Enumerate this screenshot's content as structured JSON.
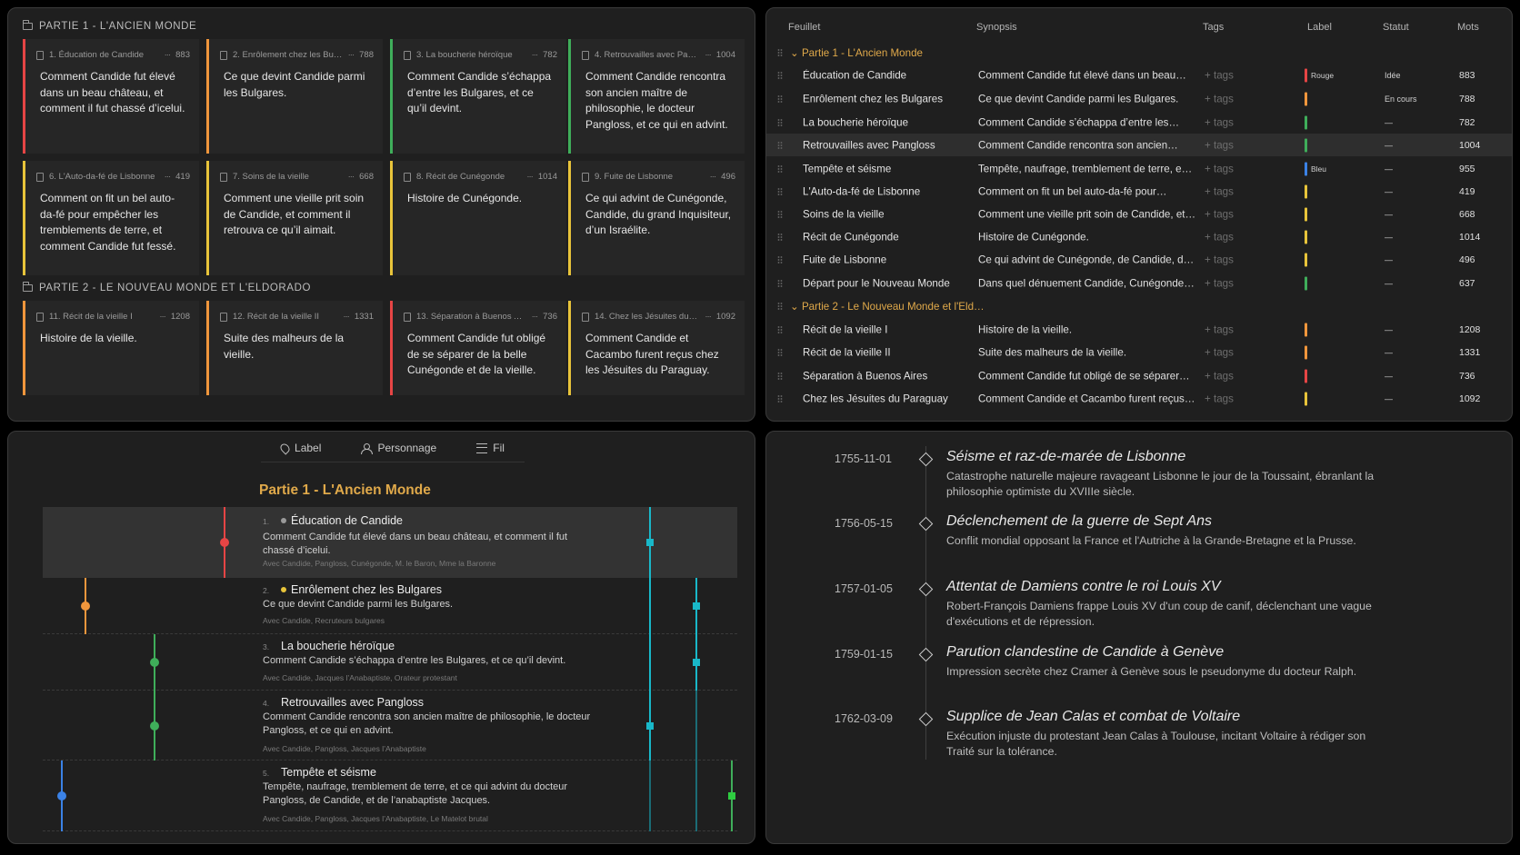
{
  "colors": {
    "bg": "#1f1f1f",
    "accent": "#e0a94a",
    "red": "#e64545",
    "orange": "#f0963c",
    "green": "#3fae5a",
    "yellow": "#e8c43a",
    "blue": "#3b82e6",
    "teal": "#19b8c9"
  },
  "corkboard": {
    "parts": [
      {
        "heading": "PARTIE 1 - L'ANCIEN MONDE",
        "cards": [
          {
            "title": "1. Éducation de Candide",
            "count": "883",
            "color": "red",
            "body": "Comment Candide fut élevé dans un beau château, et comment il fut chassé d’icelui."
          },
          {
            "title": "2. Enrôlement chez les Bulg…",
            "count": "788",
            "color": "orange",
            "body": "Ce que devint Candide parmi les Bulgares."
          },
          {
            "title": "3. La boucherie héroïque",
            "count": "782",
            "color": "green",
            "body": "Comment Candide s’échappa d’entre les Bulgares, et ce qu’il devint."
          },
          {
            "title": "4. Retrouvailles avec Pang…",
            "count": "1004",
            "color": "green",
            "body": "Comment Candide rencontra son ancien maître de philosophie, le docteur Pangloss, et ce qui en advint."
          },
          {
            "title": "6. L'Auto-da-fé de Lisbonne",
            "count": "419",
            "color": "yellow",
            "body": "Comment on fit un bel auto-da-fé pour empêcher les tremblements de terre, et comment Candide fut fessé."
          },
          {
            "title": "7. Soins de la vieille",
            "count": "668",
            "color": "yellow",
            "body": "Comment une vieille prit soin de Candide, et comment il retrouva ce qu’il aimait."
          },
          {
            "title": "8. Récit de Cunégonde",
            "count": "1014",
            "color": "yellow",
            "body": "Histoire de Cunégonde."
          },
          {
            "title": "9. Fuite de Lisbonne",
            "count": "496",
            "color": "yellow",
            "body": "Ce qui advint de Cunégonde, Candide, du grand Inquisiteur, d’un Israélite."
          }
        ]
      },
      {
        "heading": "PARTIE 2 - LE NOUVEAU MONDE ET L'ELDORADO",
        "cards": [
          {
            "title": "11. Récit de la vieille I",
            "count": "1208",
            "color": "orange",
            "body": "Histoire de la vieille."
          },
          {
            "title": "12. Récit de la vieille II",
            "count": "1331",
            "color": "orange",
            "body": "Suite des malheurs de la vieille."
          },
          {
            "title": "13. Séparation à Buenos Ai…",
            "count": "736",
            "color": "red",
            "body": "Comment Candide fut obligé de se séparer de la belle Cunégonde et de la vieille."
          },
          {
            "title": "14. Chez les Jésuites du…",
            "count": "1092",
            "color": "yellow",
            "body": "Comment Candide et Cacambo furent reçus chez les Jésuites du Paraguay."
          }
        ]
      }
    ]
  },
  "outline": {
    "headers": {
      "feuillet": "Feuillet",
      "synopsis": "Synopsis",
      "tags": "Tags",
      "label": "Label",
      "statut": "Statut",
      "mots": "Mots"
    },
    "rows": [
      {
        "kind": "part",
        "title": "Partie 1 - L'Ancien Monde"
      },
      {
        "kind": "doc",
        "title": "Éducation de Candide",
        "synopsis": "Comment Candide fut élevé dans un beau…",
        "tags": "+ tags",
        "color": "red",
        "label": "Rouge",
        "status": "Idée",
        "words": "883"
      },
      {
        "kind": "doc",
        "title": "Enrôlement chez les Bulgares",
        "synopsis": "Ce que devint Candide parmi les Bulgares.",
        "tags": "+ tags",
        "color": "orange",
        "label": "",
        "status": "En cours",
        "words": "788"
      },
      {
        "kind": "doc",
        "title": "La boucherie héroïque",
        "synopsis": "Comment Candide s’échappa d’entre les…",
        "tags": "+ tags",
        "color": "green",
        "label": "",
        "status": "—",
        "words": "782"
      },
      {
        "kind": "doc",
        "title": "Retrouvailles avec Pangloss",
        "synopsis": "Comment Candide rencontra son ancien…",
        "tags": "+ tags",
        "color": "green",
        "label": "",
        "status": "—",
        "words": "1004",
        "highlight": true
      },
      {
        "kind": "doc",
        "title": "Tempête et séisme",
        "synopsis": "Tempête, naufrage, tremblement de terre, e…",
        "tags": "+ tags",
        "color": "blue",
        "label": "Bleu",
        "status": "—",
        "words": "955"
      },
      {
        "kind": "doc",
        "title": "L'Auto-da-fé de Lisbonne",
        "synopsis": "Comment on fit un bel auto-da-fé pour…",
        "tags": "+ tags",
        "color": "yellow",
        "label": "",
        "status": "—",
        "words": "419"
      },
      {
        "kind": "doc",
        "title": "Soins de la vieille",
        "synopsis": "Comment une vieille prit soin de Candide, et…",
        "tags": "+ tags",
        "color": "yellow",
        "label": "",
        "status": "—",
        "words": "668"
      },
      {
        "kind": "doc",
        "title": "Récit de Cunégonde",
        "synopsis": "Histoire de Cunégonde.",
        "tags": "+ tags",
        "color": "yellow",
        "label": "",
        "status": "—",
        "words": "1014"
      },
      {
        "kind": "doc",
        "title": "Fuite de Lisbonne",
        "synopsis": "Ce qui advint de Cunégonde, de Candide, d…",
        "tags": "+ tags",
        "color": "yellow",
        "label": "",
        "status": "—",
        "words": "496"
      },
      {
        "kind": "doc",
        "title": "Départ pour le Nouveau Monde",
        "synopsis": "Dans quel dénuement Candide, Cunégonde…",
        "tags": "+ tags",
        "color": "green",
        "label": "",
        "status": "—",
        "words": "637"
      },
      {
        "kind": "part",
        "title": "Partie 2 - Le Nouveau Monde et l'Eld…"
      },
      {
        "kind": "doc",
        "title": "Récit de la vieille I",
        "synopsis": "Histoire de la vieille.",
        "tags": "+ tags",
        "color": "orange",
        "label": "",
        "status": "—",
        "words": "1208"
      },
      {
        "kind": "doc",
        "title": "Récit de la vieille II",
        "synopsis": "Suite des malheurs de la vieille.",
        "tags": "+ tags",
        "color": "orange",
        "label": "",
        "status": "—",
        "words": "1331"
      },
      {
        "kind": "doc",
        "title": "Séparation à Buenos Aires",
        "synopsis": "Comment Candide fut obligé de se séparer…",
        "tags": "+ tags",
        "color": "red",
        "label": "",
        "status": "—",
        "words": "736"
      },
      {
        "kind": "doc",
        "title": "Chez les Jésuites du Paraguay",
        "synopsis": "Comment Candide et Cacambo furent reçus…",
        "tags": "+ tags",
        "color": "yellow",
        "label": "",
        "status": "—",
        "words": "1092"
      }
    ]
  },
  "threads": {
    "toolbar": {
      "label": "Label",
      "personnage": "Personnage",
      "fil": "Fil"
    },
    "part_title": "Partie 1 - L'Ancien Monde",
    "rows": [
      {
        "num": "1.",
        "title": "Éducation de Candide",
        "dot": "#9a9a9a",
        "synopsis": "Comment Candide fut élevé dans un beau château, et comment il fut chassé d’icelui.",
        "characters": "Avec Candide, Pangloss, Cunégonde, M. le Baron, Mme la Baronne",
        "highlight": true
      },
      {
        "num": "2.",
        "title": "Enrôlement chez les Bulgares",
        "dot": "#e8c43a",
        "synopsis": "Ce que devint Candide parmi les Bulgares.",
        "characters": "Avec Candide, Recruteurs bulgares"
      },
      {
        "num": "3.",
        "title": "La boucherie héroïque",
        "dot": "",
        "synopsis": "Comment Candide s’échappa d’entre les Bulgares, et ce qu’il devint.",
        "characters": "Avec Candide, Jacques l’Anabaptiste, Orateur protestant"
      },
      {
        "num": "4.",
        "title": "Retrouvailles avec Pangloss",
        "dot": "",
        "synopsis": "Comment Candide rencontra son ancien maître de philosophie, le docteur Pangloss, et ce qui en advint.",
        "characters": "Avec Candide, Pangloss, Jacques l’Anabaptiste"
      },
      {
        "num": "5.",
        "title": "Tempête et séisme",
        "dot": "",
        "synopsis": "Tempête, naufrage, tremblement de terre, et ce qui advint du docteur Pangloss, de Candide, et de l’anabaptiste Jacques.",
        "characters": "Avec Candide, Pangloss, Jacques l’Anabaptiste, Le Matelot brutal"
      }
    ]
  },
  "timeline": {
    "events": [
      {
        "date": "1755-11-01",
        "title": "Séisme et raz-de-marée de Lisbonne",
        "desc": "Catastrophe naturelle majeure ravageant Lisbonne le jour de la Toussaint, ébranlant la philosophie optimiste du XVIIIe siècle."
      },
      {
        "date": "1756-05-15",
        "title": "Déclenchement de la guerre de Sept Ans",
        "desc": "Conflit mondial opposant la France et l'Autriche à la Grande-Bretagne et la Prusse."
      },
      {
        "date": "1757-01-05",
        "title": "Attentat de Damiens contre le roi Louis XV",
        "desc": "Robert-François Damiens frappe Louis XV d'un coup de canif, déclenchant une vague d'exécutions et de répression."
      },
      {
        "date": "1759-01-15",
        "title": "Parution clandestine de Candide à Genève",
        "desc": "Impression secrète chez Cramer à Genève sous le pseudonyme du docteur Ralph."
      },
      {
        "date": "1762-03-09",
        "title": "Supplice de Jean Calas et combat de Voltaire",
        "desc": "Exécution injuste du protestant Jean Calas à Toulouse, incitant Voltaire à rédiger son Traité sur la tolérance."
      }
    ]
  }
}
